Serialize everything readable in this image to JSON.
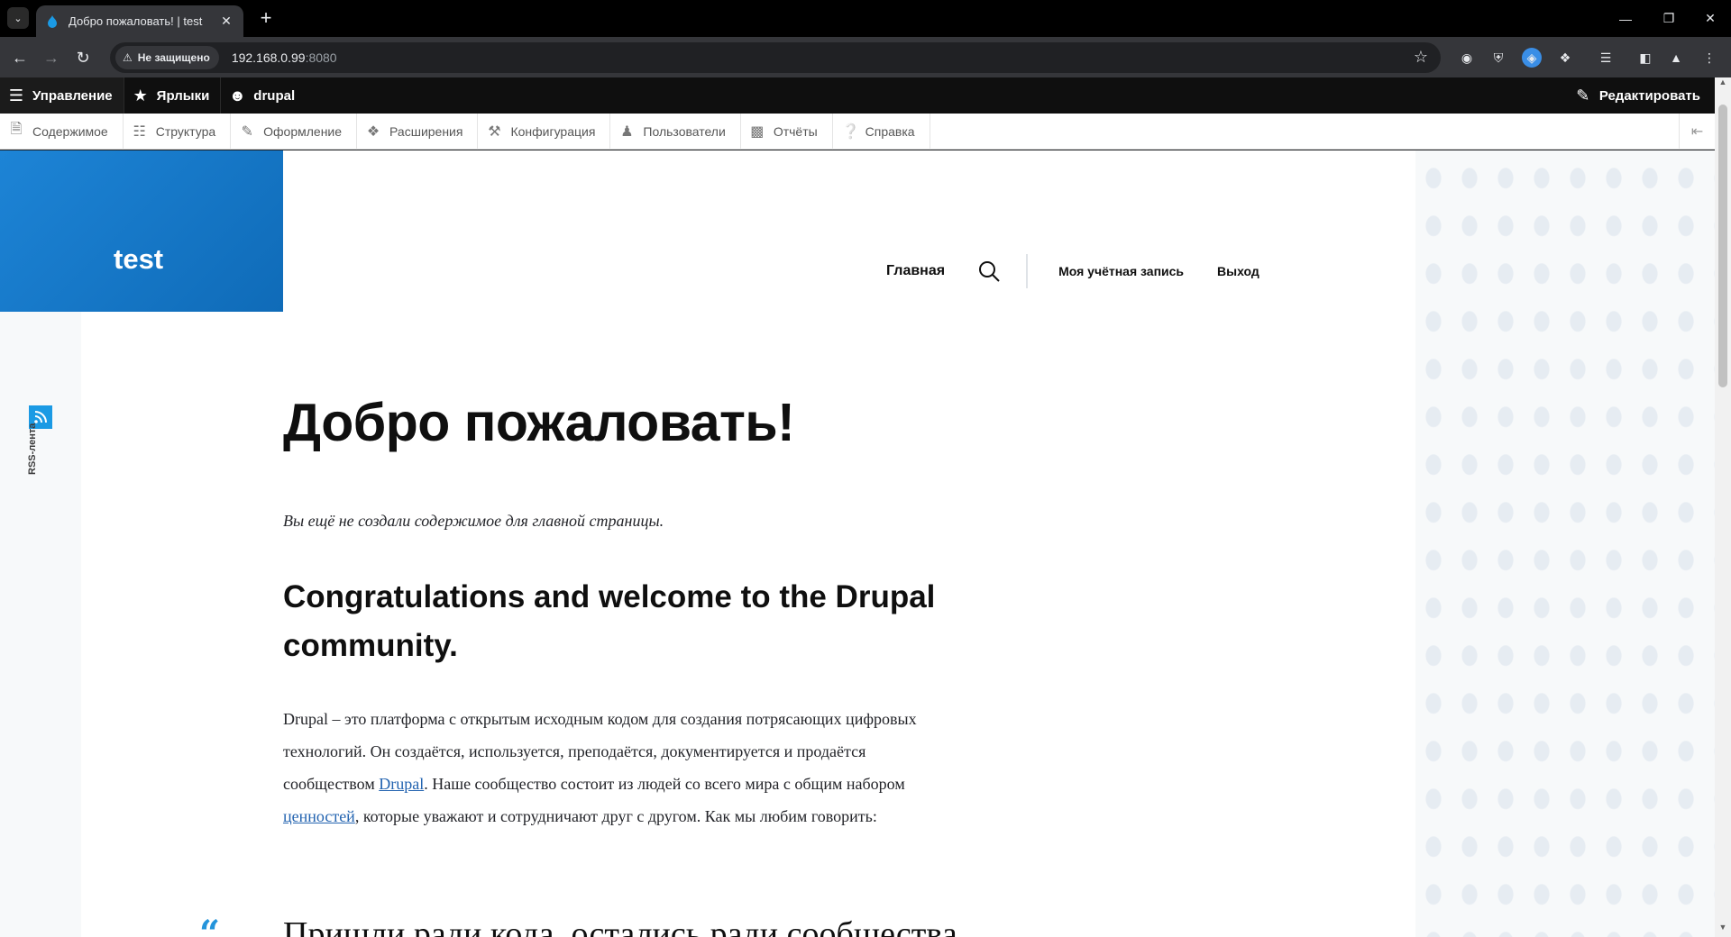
{
  "browser": {
    "tab_title": "Добро пожаловать! | test",
    "security_label": "Не защищено",
    "url_host": "192.168.0.99",
    "url_port": ":8080"
  },
  "admin_toolbar": {
    "manage": "Управление",
    "shortcuts": "Ярлыки",
    "user": "drupal",
    "edit": "Редактировать"
  },
  "admin_tray": {
    "items": [
      {
        "label": "Содержимое",
        "icon": "file-icon"
      },
      {
        "label": "Структура",
        "icon": "structure-icon"
      },
      {
        "label": "Оформление",
        "icon": "brush-icon"
      },
      {
        "label": "Расширения",
        "icon": "puzzle-icon"
      },
      {
        "label": "Конфигурация",
        "icon": "wrench-icon"
      },
      {
        "label": "Пользователи",
        "icon": "people-icon"
      },
      {
        "label": "Отчёты",
        "icon": "bar-chart-icon"
      },
      {
        "label": "Справка",
        "icon": "help-icon"
      }
    ]
  },
  "site": {
    "name": "test",
    "brand_color": "#1d84d6"
  },
  "nav": {
    "home": "Главная",
    "account": "Моя учётная запись",
    "logout": "Выход"
  },
  "sidebar": {
    "rss_label": "RSS-лента"
  },
  "content": {
    "title": "Добро пожаловать!",
    "empty_message": "Вы ещё не создали содержимое для главной страницы.",
    "heading": "Congratulations and welcome to the Drupal community.",
    "paragraph_part1": "Drupal – это платформа с открытым исходным кодом для создания потрясающих цифровых технологий. Он создаётся, используется, преподаётся, документируется и продаётся сообществом ",
    "link_drupal": "Drupal",
    "paragraph_part2": ". Наше сообщество состоит из людей со всего мира с общим набором ",
    "link_values": "ценностей",
    "paragraph_part3": ", которые уважают и сотрудничают друг с другом. Как мы любим говорить:",
    "quote_mark": "“",
    "quote_text": "Пришли ради кода, остались ради сообщества."
  }
}
